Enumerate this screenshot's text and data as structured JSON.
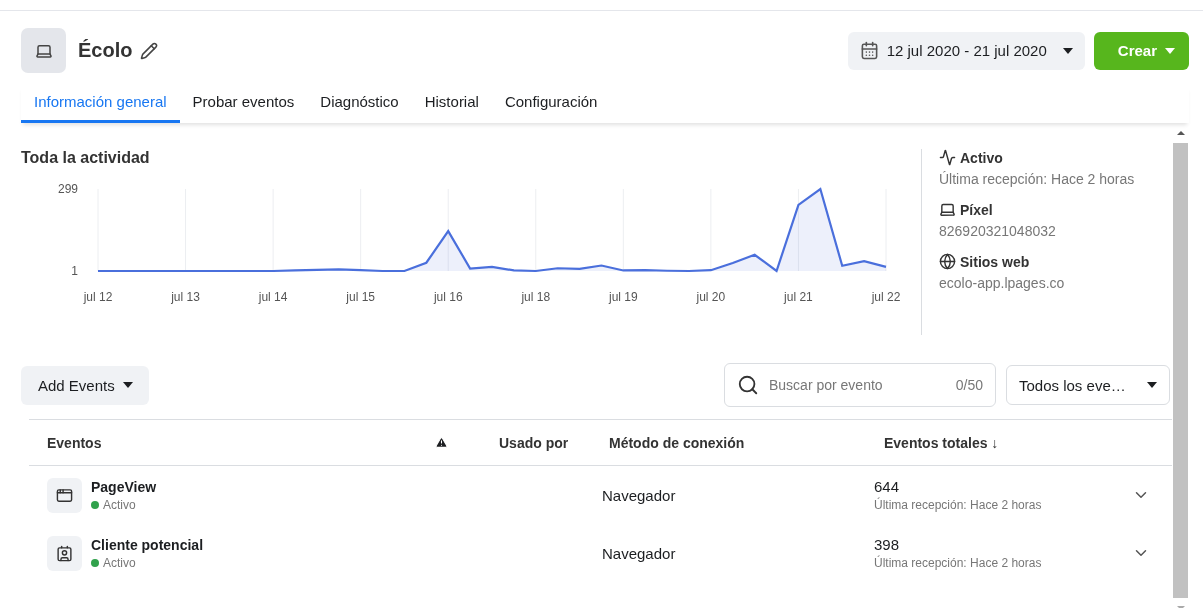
{
  "header": {
    "title": "Écolo",
    "date_range": "12 jul 2020 - 21 jul 2020",
    "create_button": "Crear"
  },
  "tabs": [
    {
      "label": "Información general",
      "selected": true
    },
    {
      "label": "Probar eventos",
      "selected": false
    },
    {
      "label": "Diagnóstico",
      "selected": false
    },
    {
      "label": "Historial",
      "selected": false
    },
    {
      "label": "Configuración",
      "selected": false
    }
  ],
  "activity": {
    "title": "Toda la actividad",
    "chart_data": {
      "type": "area",
      "categories": [
        "jul 12",
        null,
        null,
        null,
        "jul 13",
        null,
        null,
        null,
        "jul 14",
        null,
        null,
        null,
        "jul 15",
        null,
        null,
        null,
        "jul 16",
        null,
        null,
        null,
        "jul 18",
        null,
        null,
        null,
        "jul 19",
        null,
        null,
        null,
        "jul 20",
        null,
        null,
        null,
        "jul 21",
        null,
        null,
        null,
        "jul 22"
      ],
      "series": [
        {
          "color": "#4a6fdc",
          "values": [
            1,
            1,
            1,
            1,
            1,
            1,
            1,
            1,
            1,
            3,
            5,
            7,
            4,
            1,
            1,
            31,
            146,
            10,
            16,
            3,
            1,
            11,
            9,
            21,
            3,
            4,
            2,
            1,
            4,
            30,
            60,
            1,
            241,
            299,
            20,
            37,
            16
          ]
        }
      ],
      "ylim": [
        1,
        299
      ],
      "yticks": [
        1,
        299
      ],
      "grid": true
    }
  },
  "info": [
    {
      "kind": "activity",
      "label": "Activo",
      "value": "Última recepción: Hace 2 horas"
    },
    {
      "kind": "pixel",
      "label": "Píxel",
      "value": "826920321048032"
    },
    {
      "kind": "web",
      "label": "Sitios web",
      "value": "ecolo-app.lpages.co"
    }
  ],
  "toolbar": {
    "add_events": "Add Events",
    "search": {
      "placeholder": "Buscar por evento",
      "count": "0/50"
    },
    "filter": "Todos los eve…"
  },
  "table": {
    "columns": [
      {
        "kind": "text",
        "label": "Eventos"
      },
      {
        "kind": "warning"
      },
      {
        "kind": "text",
        "label": "Usado por"
      },
      {
        "kind": "text",
        "label": "Método de conexión"
      },
      {
        "kind": "text",
        "label": "Eventos totales ↓"
      }
    ],
    "rows": [
      {
        "kind": "page",
        "name": "PageView",
        "status": "Activo",
        "color": "#31a24c",
        "method": "Navegador",
        "total": "644",
        "last": "Última recepción: Hace 2 horas"
      },
      {
        "kind": "lead",
        "name": "Cliente potencial",
        "status": "Activo",
        "color": "#31a24c",
        "method": "Navegador",
        "total": "398",
        "last": "Última recepción: Hace 2 horas"
      }
    ]
  }
}
